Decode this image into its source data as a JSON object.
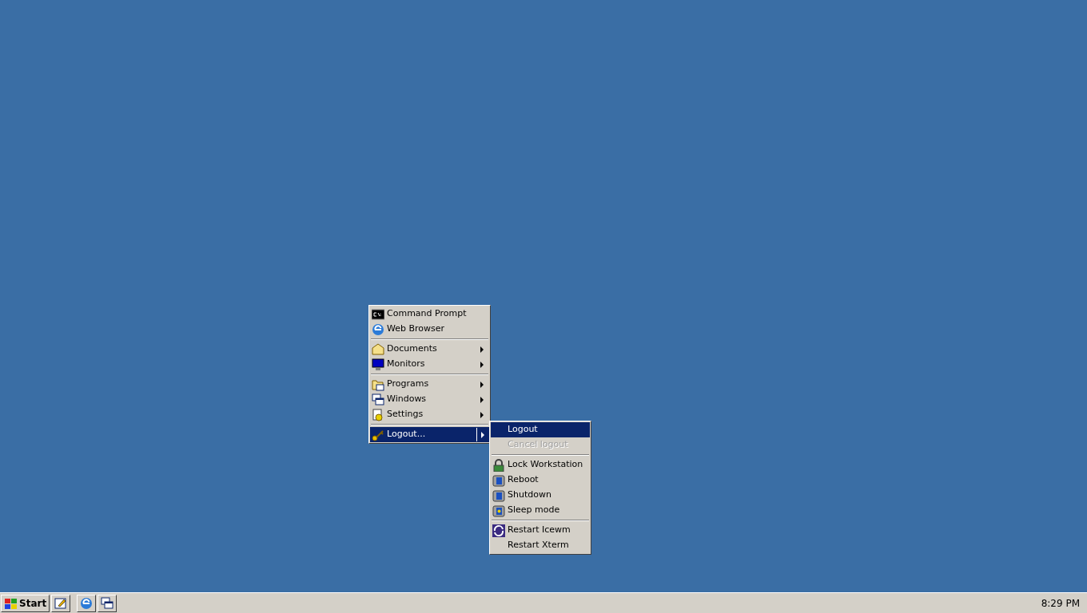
{
  "start_menu": {
    "items": [
      {
        "kind": "item",
        "label": "Command Prompt",
        "submenu": false,
        "selected": false
      },
      {
        "kind": "item",
        "label": "Web Browser",
        "submenu": false,
        "selected": false
      },
      {
        "kind": "separator"
      },
      {
        "kind": "item",
        "label": "Documents",
        "submenu": true,
        "selected": false
      },
      {
        "kind": "item",
        "label": "Monitors",
        "submenu": true,
        "selected": false
      },
      {
        "kind": "separator"
      },
      {
        "kind": "item",
        "label": "Programs",
        "submenu": true,
        "selected": false
      },
      {
        "kind": "item",
        "label": "Windows",
        "submenu": true,
        "selected": false
      },
      {
        "kind": "item",
        "label": "Settings",
        "submenu": true,
        "selected": false
      },
      {
        "kind": "separator"
      },
      {
        "kind": "item",
        "label": "Logout...",
        "submenu": true,
        "selected": true
      }
    ]
  },
  "logout_menu": {
    "items": [
      {
        "kind": "item",
        "label": "Logout",
        "disabled": false,
        "selected": true
      },
      {
        "kind": "item",
        "label": "Cancel logout",
        "disabled": true,
        "selected": false
      },
      {
        "kind": "separator"
      },
      {
        "kind": "item",
        "label": "Lock Workstation",
        "disabled": false,
        "selected": false
      },
      {
        "kind": "item",
        "label": "Reboot",
        "disabled": false,
        "selected": false
      },
      {
        "kind": "item",
        "label": "Shutdown",
        "disabled": false,
        "selected": false
      },
      {
        "kind": "item",
        "label": "Sleep mode",
        "disabled": false,
        "selected": false
      },
      {
        "kind": "separator"
      },
      {
        "kind": "item",
        "label": "Restart Icewm",
        "disabled": false,
        "selected": false
      },
      {
        "kind": "item",
        "label": "Restart Xterm",
        "disabled": false,
        "selected": false
      }
    ]
  },
  "taskbar": {
    "start_label": "Start",
    "clock": "8:29 PM"
  }
}
